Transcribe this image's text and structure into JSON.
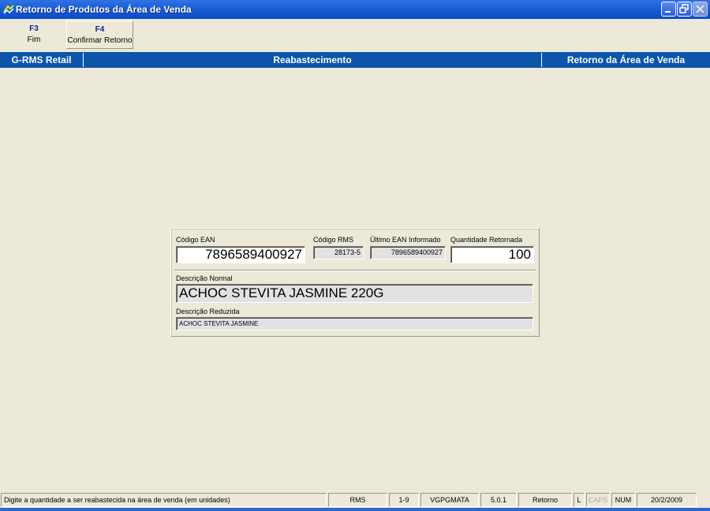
{
  "window": {
    "title": "Retorno de Produtos da Área de Venda"
  },
  "toolbar": {
    "buttons": [
      {
        "key": "F3",
        "label": "Fim"
      },
      {
        "key": "F4",
        "label": "Confirmar Retorno"
      }
    ]
  },
  "header_band": {
    "left": "G-RMS Retail",
    "center": "Reabastecimento",
    "right": "Retorno da Área de Venda"
  },
  "form": {
    "codigo_ean": {
      "label": "Código EAN",
      "value": "7896589400927"
    },
    "codigo_rms": {
      "label": "Código RMS",
      "value": "28173-5"
    },
    "ultimo_ean": {
      "label": "Último EAN Informado",
      "value": "7896589400927"
    },
    "quantidade": {
      "label": "Quantidade Retornada",
      "value": "100"
    },
    "descricao_normal": {
      "label": "Descrição Normal",
      "value": "ACHOC STEVITA JASMINE 220G"
    },
    "descricao_reduzida": {
      "label": "Descrição Reduzida",
      "value": "ACHOC STEVITA JASMINE"
    }
  },
  "statusbar": {
    "message": "Digite a quantidade a ser reabastecida na área de venda (em unidades)",
    "system": "RMS",
    "code": "1-9",
    "user": "VGPGMATA",
    "version": "5.0.1",
    "mode": "Retorno",
    "l_indicator": "L",
    "caps": "CAPS",
    "num": "NUM",
    "date": "20/2/2009"
  },
  "colors": {
    "title_bar": "#0A4BC8",
    "header_band": "#0B55AB",
    "background": "#ECE9D8",
    "readonly_field": "#E2E2E2"
  },
  "icons": {
    "app": "rms-app-icon",
    "minimize": "minimize-icon",
    "restore": "restore-icon",
    "close": "close-icon"
  }
}
